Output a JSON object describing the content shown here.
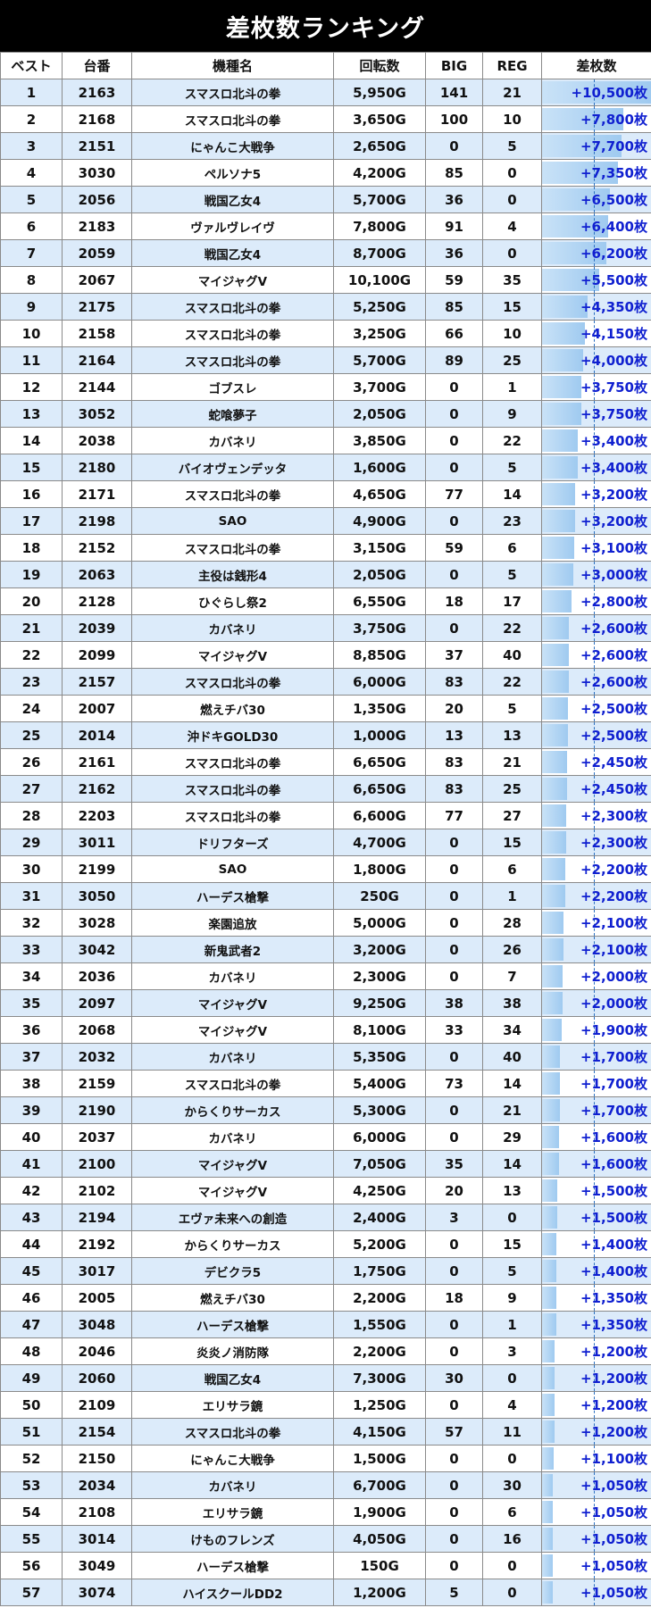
{
  "title": "差枚数ランキング",
  "headers": [
    "ベスト",
    "台番",
    "機種名",
    "回転数",
    "BIG",
    "REG",
    "差枚数"
  ],
  "bar_max": 10500,
  "rows": [
    {
      "rank": "1",
      "unit": "2163",
      "machine": "スマスロ北斗の拳",
      "spins": "5,950G",
      "big": "141",
      "reg": "21",
      "diff": "+10,500枚",
      "diff_value": 10500
    },
    {
      "rank": "2",
      "unit": "2168",
      "machine": "スマスロ北斗の拳",
      "spins": "3,650G",
      "big": "100",
      "reg": "10",
      "diff": "+7,800枚",
      "diff_value": 7800
    },
    {
      "rank": "3",
      "unit": "2151",
      "machine": "にゃんこ大戦争",
      "spins": "2,650G",
      "big": "0",
      "reg": "5",
      "diff": "+7,700枚",
      "diff_value": 7700
    },
    {
      "rank": "4",
      "unit": "3030",
      "machine": "ペルソナ5",
      "spins": "4,200G",
      "big": "85",
      "reg": "0",
      "diff": "+7,350枚",
      "diff_value": 7350
    },
    {
      "rank": "5",
      "unit": "2056",
      "machine": "戦国乙女4",
      "spins": "5,700G",
      "big": "36",
      "reg": "0",
      "diff": "+6,500枚",
      "diff_value": 6500
    },
    {
      "rank": "6",
      "unit": "2183",
      "machine": "ヴァルヴレイヴ",
      "spins": "7,800G",
      "big": "91",
      "reg": "4",
      "diff": "+6,400枚",
      "diff_value": 6400
    },
    {
      "rank": "7",
      "unit": "2059",
      "machine": "戦国乙女4",
      "spins": "8,700G",
      "big": "36",
      "reg": "0",
      "diff": "+6,200枚",
      "diff_value": 6200
    },
    {
      "rank": "8",
      "unit": "2067",
      "machine": "マイジャグV",
      "spins": "10,100G",
      "big": "59",
      "reg": "35",
      "diff": "+5,500枚",
      "diff_value": 5500
    },
    {
      "rank": "9",
      "unit": "2175",
      "machine": "スマスロ北斗の拳",
      "spins": "5,250G",
      "big": "85",
      "reg": "15",
      "diff": "+4,350枚",
      "diff_value": 4350
    },
    {
      "rank": "10",
      "unit": "2158",
      "machine": "スマスロ北斗の拳",
      "spins": "3,250G",
      "big": "66",
      "reg": "10",
      "diff": "+4,150枚",
      "diff_value": 4150
    },
    {
      "rank": "11",
      "unit": "2164",
      "machine": "スマスロ北斗の拳",
      "spins": "5,700G",
      "big": "89",
      "reg": "25",
      "diff": "+4,000枚",
      "diff_value": 4000
    },
    {
      "rank": "12",
      "unit": "2144",
      "machine": "ゴブスレ",
      "spins": "3,700G",
      "big": "0",
      "reg": "1",
      "diff": "+3,750枚",
      "diff_value": 3750
    },
    {
      "rank": "13",
      "unit": "3052",
      "machine": "蛇喰夢子",
      "spins": "2,050G",
      "big": "0",
      "reg": "9",
      "diff": "+3,750枚",
      "diff_value": 3750
    },
    {
      "rank": "14",
      "unit": "2038",
      "machine": "カバネリ",
      "spins": "3,850G",
      "big": "0",
      "reg": "22",
      "diff": "+3,400枚",
      "diff_value": 3400
    },
    {
      "rank": "15",
      "unit": "2180",
      "machine": "バイオヴェンデッタ",
      "spins": "1,600G",
      "big": "0",
      "reg": "5",
      "diff": "+3,400枚",
      "diff_value": 3400
    },
    {
      "rank": "16",
      "unit": "2171",
      "machine": "スマスロ北斗の拳",
      "spins": "4,650G",
      "big": "77",
      "reg": "14",
      "diff": "+3,200枚",
      "diff_value": 3200
    },
    {
      "rank": "17",
      "unit": "2198",
      "machine": "SAO",
      "spins": "4,900G",
      "big": "0",
      "reg": "23",
      "diff": "+3,200枚",
      "diff_value": 3200
    },
    {
      "rank": "18",
      "unit": "2152",
      "machine": "スマスロ北斗の拳",
      "spins": "3,150G",
      "big": "59",
      "reg": "6",
      "diff": "+3,100枚",
      "diff_value": 3100
    },
    {
      "rank": "19",
      "unit": "2063",
      "machine": "主役は銭形4",
      "spins": "2,050G",
      "big": "0",
      "reg": "5",
      "diff": "+3,000枚",
      "diff_value": 3000
    },
    {
      "rank": "20",
      "unit": "2128",
      "machine": "ひぐらし祭2",
      "spins": "6,550G",
      "big": "18",
      "reg": "17",
      "diff": "+2,800枚",
      "diff_value": 2800
    },
    {
      "rank": "21",
      "unit": "2039",
      "machine": "カバネリ",
      "spins": "3,750G",
      "big": "0",
      "reg": "22",
      "diff": "+2,600枚",
      "diff_value": 2600
    },
    {
      "rank": "22",
      "unit": "2099",
      "machine": "マイジャグV",
      "spins": "8,850G",
      "big": "37",
      "reg": "40",
      "diff": "+2,600枚",
      "diff_value": 2600
    },
    {
      "rank": "23",
      "unit": "2157",
      "machine": "スマスロ北斗の拳",
      "spins": "6,000G",
      "big": "83",
      "reg": "22",
      "diff": "+2,600枚",
      "diff_value": 2600
    },
    {
      "rank": "24",
      "unit": "2007",
      "machine": "燃えチバ30",
      "spins": "1,350G",
      "big": "20",
      "reg": "5",
      "diff": "+2,500枚",
      "diff_value": 2500
    },
    {
      "rank": "25",
      "unit": "2014",
      "machine": "沖ドキGOLD30",
      "spins": "1,000G",
      "big": "13",
      "reg": "13",
      "diff": "+2,500枚",
      "diff_value": 2500
    },
    {
      "rank": "26",
      "unit": "2161",
      "machine": "スマスロ北斗の拳",
      "spins": "6,650G",
      "big": "83",
      "reg": "21",
      "diff": "+2,450枚",
      "diff_value": 2450
    },
    {
      "rank": "27",
      "unit": "2162",
      "machine": "スマスロ北斗の拳",
      "spins": "6,650G",
      "big": "83",
      "reg": "25",
      "diff": "+2,450枚",
      "diff_value": 2450
    },
    {
      "rank": "28",
      "unit": "2203",
      "machine": "スマスロ北斗の拳",
      "spins": "6,600G",
      "big": "77",
      "reg": "27",
      "diff": "+2,300枚",
      "diff_value": 2300
    },
    {
      "rank": "29",
      "unit": "3011",
      "machine": "ドリフターズ",
      "spins": "4,700G",
      "big": "0",
      "reg": "15",
      "diff": "+2,300枚",
      "diff_value": 2300
    },
    {
      "rank": "30",
      "unit": "2199",
      "machine": "SAO",
      "spins": "1,800G",
      "big": "0",
      "reg": "6",
      "diff": "+2,200枚",
      "diff_value": 2200
    },
    {
      "rank": "31",
      "unit": "3050",
      "machine": "ハーデス槍撃",
      "spins": "250G",
      "big": "0",
      "reg": "1",
      "diff": "+2,200枚",
      "diff_value": 2200
    },
    {
      "rank": "32",
      "unit": "3028",
      "machine": "楽園追放",
      "spins": "5,000G",
      "big": "0",
      "reg": "28",
      "diff": "+2,100枚",
      "diff_value": 2100
    },
    {
      "rank": "33",
      "unit": "3042",
      "machine": "新鬼武者2",
      "spins": "3,200G",
      "big": "0",
      "reg": "26",
      "diff": "+2,100枚",
      "diff_value": 2100
    },
    {
      "rank": "34",
      "unit": "2036",
      "machine": "カバネリ",
      "spins": "2,300G",
      "big": "0",
      "reg": "7",
      "diff": "+2,000枚",
      "diff_value": 2000
    },
    {
      "rank": "35",
      "unit": "2097",
      "machine": "マイジャグV",
      "spins": "9,250G",
      "big": "38",
      "reg": "38",
      "diff": "+2,000枚",
      "diff_value": 2000
    },
    {
      "rank": "36",
      "unit": "2068",
      "machine": "マイジャグV",
      "spins": "8,100G",
      "big": "33",
      "reg": "34",
      "diff": "+1,900枚",
      "diff_value": 1900
    },
    {
      "rank": "37",
      "unit": "2032",
      "machine": "カバネリ",
      "spins": "5,350G",
      "big": "0",
      "reg": "40",
      "diff": "+1,700枚",
      "diff_value": 1700
    },
    {
      "rank": "38",
      "unit": "2159",
      "machine": "スマスロ北斗の拳",
      "spins": "5,400G",
      "big": "73",
      "reg": "14",
      "diff": "+1,700枚",
      "diff_value": 1700
    },
    {
      "rank": "39",
      "unit": "2190",
      "machine": "からくりサーカス",
      "spins": "5,300G",
      "big": "0",
      "reg": "21",
      "diff": "+1,700枚",
      "diff_value": 1700
    },
    {
      "rank": "40",
      "unit": "2037",
      "machine": "カバネリ",
      "spins": "6,000G",
      "big": "0",
      "reg": "29",
      "diff": "+1,600枚",
      "diff_value": 1600
    },
    {
      "rank": "41",
      "unit": "2100",
      "machine": "マイジャグV",
      "spins": "7,050G",
      "big": "35",
      "reg": "14",
      "diff": "+1,600枚",
      "diff_value": 1600
    },
    {
      "rank": "42",
      "unit": "2102",
      "machine": "マイジャグV",
      "spins": "4,250G",
      "big": "20",
      "reg": "13",
      "diff": "+1,500枚",
      "diff_value": 1500
    },
    {
      "rank": "43",
      "unit": "2194",
      "machine": "エヴァ未来への創造",
      "spins": "2,400G",
      "big": "3",
      "reg": "0",
      "diff": "+1,500枚",
      "diff_value": 1500
    },
    {
      "rank": "44",
      "unit": "2192",
      "machine": "からくりサーカス",
      "spins": "5,200G",
      "big": "0",
      "reg": "15",
      "diff": "+1,400枚",
      "diff_value": 1400
    },
    {
      "rank": "45",
      "unit": "3017",
      "machine": "デビクラ5",
      "spins": "1,750G",
      "big": "0",
      "reg": "5",
      "diff": "+1,400枚",
      "diff_value": 1400
    },
    {
      "rank": "46",
      "unit": "2005",
      "machine": "燃えチバ30",
      "spins": "2,200G",
      "big": "18",
      "reg": "9",
      "diff": "+1,350枚",
      "diff_value": 1350
    },
    {
      "rank": "47",
      "unit": "3048",
      "machine": "ハーデス槍撃",
      "spins": "1,550G",
      "big": "0",
      "reg": "1",
      "diff": "+1,350枚",
      "diff_value": 1350
    },
    {
      "rank": "48",
      "unit": "2046",
      "machine": "炎炎ノ消防隊",
      "spins": "2,200G",
      "big": "0",
      "reg": "3",
      "diff": "+1,200枚",
      "diff_value": 1200
    },
    {
      "rank": "49",
      "unit": "2060",
      "machine": "戦国乙女4",
      "spins": "7,300G",
      "big": "30",
      "reg": "0",
      "diff": "+1,200枚",
      "diff_value": 1200
    },
    {
      "rank": "50",
      "unit": "2109",
      "machine": "エリサラ鏡",
      "spins": "1,250G",
      "big": "0",
      "reg": "4",
      "diff": "+1,200枚",
      "diff_value": 1200
    },
    {
      "rank": "51",
      "unit": "2154",
      "machine": "スマスロ北斗の拳",
      "spins": "4,150G",
      "big": "57",
      "reg": "11",
      "diff": "+1,200枚",
      "diff_value": 1200
    },
    {
      "rank": "52",
      "unit": "2150",
      "machine": "にゃんこ大戦争",
      "spins": "1,500G",
      "big": "0",
      "reg": "0",
      "diff": "+1,100枚",
      "diff_value": 1100
    },
    {
      "rank": "53",
      "unit": "2034",
      "machine": "カバネリ",
      "spins": "6,700G",
      "big": "0",
      "reg": "30",
      "diff": "+1,050枚",
      "diff_value": 1050
    },
    {
      "rank": "54",
      "unit": "2108",
      "machine": "エリサラ鏡",
      "spins": "1,900G",
      "big": "0",
      "reg": "6",
      "diff": "+1,050枚",
      "diff_value": 1050
    },
    {
      "rank": "55",
      "unit": "3014",
      "machine": "けものフレンズ",
      "spins": "4,050G",
      "big": "0",
      "reg": "16",
      "diff": "+1,050枚",
      "diff_value": 1050
    },
    {
      "rank": "56",
      "unit": "3049",
      "machine": "ハーデス槍撃",
      "spins": "150G",
      "big": "0",
      "reg": "0",
      "diff": "+1,050枚",
      "diff_value": 1050
    },
    {
      "rank": "57",
      "unit": "3074",
      "machine": "ハイスクールDD2",
      "spins": "1,200G",
      "big": "5",
      "reg": "0",
      "diff": "+1,050枚",
      "diff_value": 1050
    }
  ]
}
